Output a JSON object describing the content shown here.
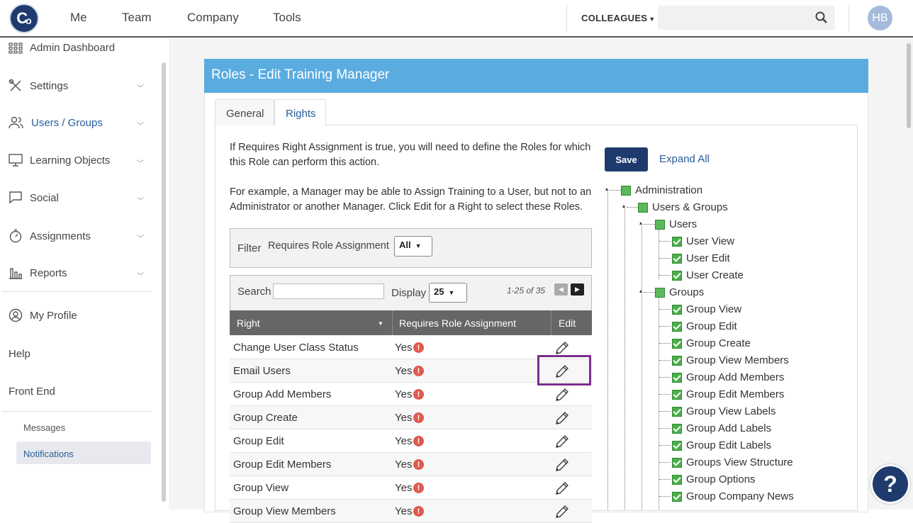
{
  "header": {
    "logo_text": "Co",
    "nav": [
      "Me",
      "Team",
      "Company",
      "Tools"
    ],
    "colleagues_label": "COLLEAGUES",
    "search_placeholder": "",
    "avatar_initials": "HB"
  },
  "sidebar": {
    "items": [
      {
        "label": "Admin Dashboard",
        "icon": "grid-icon"
      },
      {
        "label": "Settings",
        "icon": "tools-icon"
      },
      {
        "label": "Users / Groups",
        "icon": "users-icon"
      },
      {
        "label": "Learning Objects",
        "icon": "monitor-icon"
      },
      {
        "label": "Social",
        "icon": "chat-icon"
      },
      {
        "label": "Assignments",
        "icon": "stopwatch-icon"
      },
      {
        "label": "Reports",
        "icon": "bar-chart-icon"
      }
    ],
    "profile": "My Profile",
    "help": "Help",
    "front_end": "Front End",
    "messages": "Messages",
    "notifications": "Notifications"
  },
  "card": {
    "title": "Roles - Edit Training Manager",
    "tabs": [
      "General",
      "Rights"
    ],
    "active_tab": "Rights",
    "desc1": "If Requires Right Assignment is true, you will need to define the Roles for which this Role can perform this action.",
    "desc2": "For example, a Manager may be able to Assign Training to a User, but not to an Administrator or another Manager. Click Edit for a Right to select these Roles.",
    "filter_label": "Filter",
    "filter_field": "Requires Role Assignment",
    "filter_value": "All",
    "search_label": "Search",
    "display_label": "Display",
    "display_value": "25",
    "range_text": "1-25 of 35",
    "columns": [
      "Right",
      "Requires Role Assignment",
      "Edit"
    ],
    "rows": [
      {
        "right": "Change User Class Status",
        "requires": "Yes"
      },
      {
        "right": "Email Users",
        "requires": "Yes"
      },
      {
        "right": "Group Add Members",
        "requires": "Yes"
      },
      {
        "right": "Group Create",
        "requires": "Yes"
      },
      {
        "right": "Group Edit",
        "requires": "Yes"
      },
      {
        "right": "Group Edit Members",
        "requires": "Yes"
      },
      {
        "right": "Group View",
        "requires": "Yes"
      },
      {
        "right": "Group View Members",
        "requires": "Yes"
      }
    ],
    "save_label": "Save",
    "expand_label": "Expand All",
    "tree": {
      "administration": "Administration",
      "users_groups": "Users & Groups",
      "users": "Users",
      "user_items": [
        "User View",
        "User Edit",
        "User Create"
      ],
      "groups": "Groups",
      "group_items": [
        "Group View",
        "Group Edit",
        "Group Create",
        "Group View Members",
        "Group Add Members",
        "Group Edit Members",
        "Group View Labels",
        "Group Add Labels",
        "Group Edit Labels",
        "Groups View Structure",
        "Group Options",
        "Group Company News"
      ]
    }
  },
  "help_button": "?",
  "colors": {
    "header_blue": "#5aace0",
    "navy": "#1f3b6e",
    "warn": "#e05a4f",
    "highlight": "#7b2d8e"
  }
}
